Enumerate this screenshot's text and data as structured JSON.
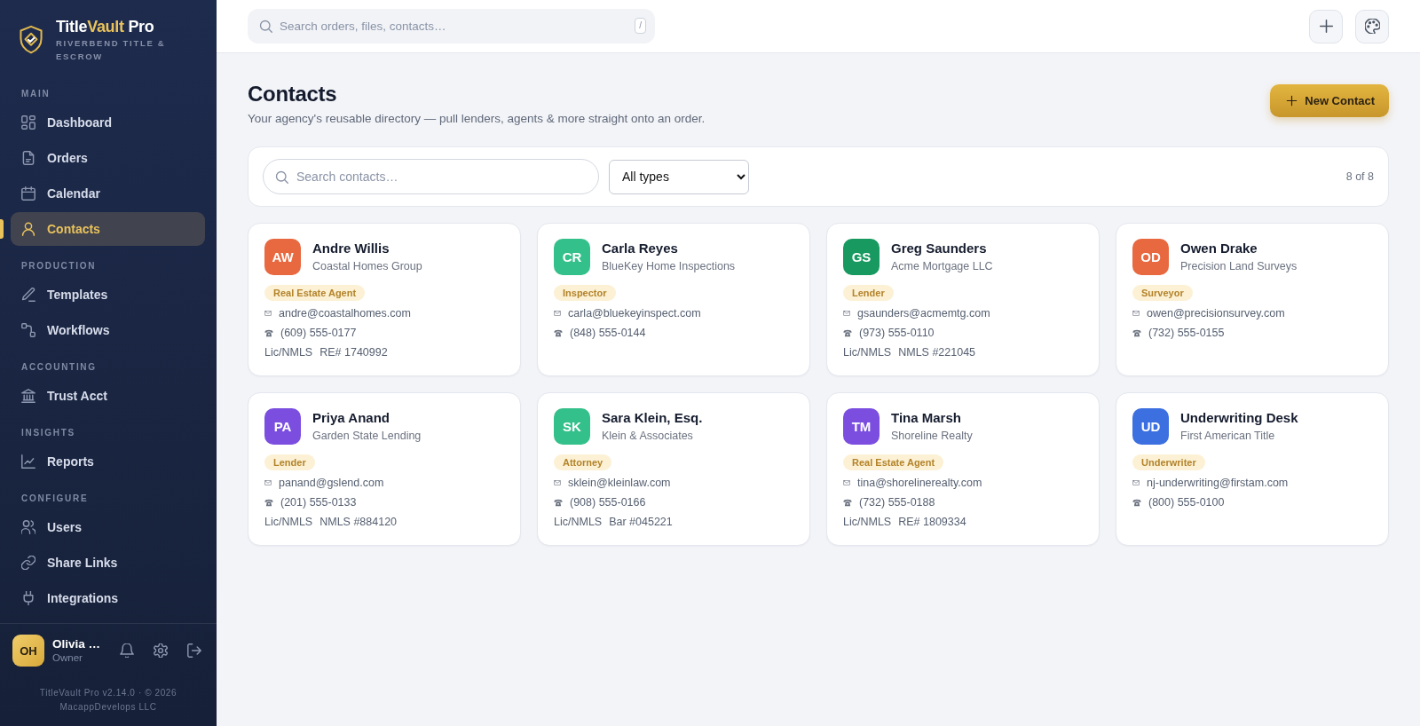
{
  "sidebar": {
    "brand": {
      "name_parts": [
        {
          "text": "Title",
          "accent": false
        },
        {
          "text": "Vault",
          "accent": true
        },
        {
          "text": " Pro",
          "accent": false
        }
      ],
      "subtitle": "RIVERBEND TITLE & ESCROW"
    },
    "sections": [
      {
        "label": "MAIN",
        "items": [
          {
            "label": "Dashboard",
            "selected": false
          },
          {
            "label": "Orders",
            "selected": false
          },
          {
            "label": "Calendar",
            "selected": false
          },
          {
            "label": "Contacts",
            "selected": true
          }
        ]
      },
      {
        "label": "PRODUCTION",
        "items": [
          {
            "label": "Templates",
            "selected": false
          },
          {
            "label": "Workflows",
            "selected": false
          }
        ]
      },
      {
        "label": "ACCOUNTING",
        "items": [
          {
            "label": "Trust Acct",
            "selected": false
          }
        ]
      },
      {
        "label": "INSIGHTS",
        "items": [
          {
            "label": "Reports",
            "selected": false
          }
        ]
      },
      {
        "label": "CONFIGURE",
        "items": [
          {
            "label": "Users",
            "selected": false
          },
          {
            "label": "Share Links",
            "selected": false
          },
          {
            "label": "Integrations",
            "selected": false
          }
        ]
      }
    ],
    "user": {
      "initials": "OH",
      "name": "Olivia …",
      "role": "Owner"
    },
    "footer": "TitleVault Pro v2.14.0 · © 2026 MacappDevelops LLC"
  },
  "topbar": {
    "search": {
      "placeholder": "Search orders, files, contacts…",
      "shortcut": "/"
    }
  },
  "page": {
    "title": "Contacts",
    "subtitle": "Your agency's reusable directory — pull lenders, agents & more straight onto an order.",
    "primary_action": "New Contact"
  },
  "filters": {
    "search_placeholder": "Search contacts…",
    "type_select": "All types",
    "count": "8 of 8"
  },
  "contacts": [
    {
      "initials": "AW",
      "name": "Andre Willis",
      "company": "Coastal Homes Group",
      "color": "#e8683f",
      "role": "Real Estate Agent",
      "email": "andre@coastalhomes.com",
      "phone": "(609) 555-0177",
      "license_label": "Lic/NMLS",
      "license": "RE# 1740992"
    },
    {
      "initials": "CR",
      "name": "Carla Reyes",
      "company": "BlueKey Home Inspections",
      "color": "#34c08a",
      "role": "Inspector",
      "email": "carla@bluekeyinspect.com",
      "phone": "(848) 555-0144"
    },
    {
      "initials": "GS",
      "name": "Greg Saunders",
      "company": "Acme Mortgage LLC",
      "color": "#17995f",
      "role": "Lender",
      "email": "gsaunders@acmemtg.com",
      "phone": "(973) 555-0110",
      "license_label": "Lic/NMLS",
      "license": "NMLS #221045"
    },
    {
      "initials": "OD",
      "name": "Owen Drake",
      "company": "Precision Land Surveys",
      "color": "#e8683f",
      "role": "Surveyor",
      "email": "owen@precisionsurvey.com",
      "phone": "(732) 555-0155"
    },
    {
      "initials": "PA",
      "name": "Priya Anand",
      "company": "Garden State Lending",
      "color": "#7b4ee0",
      "role": "Lender",
      "email": "panand@gslend.com",
      "phone": "(201) 555-0133",
      "license_label": "Lic/NMLS",
      "license": "NMLS #884120"
    },
    {
      "initials": "SK",
      "name": "Sara Klein, Esq.",
      "company": "Klein & Associates",
      "color": "#34c08a",
      "role": "Attorney",
      "email": "sklein@kleinlaw.com",
      "phone": "(908) 555-0166",
      "license_label": "Lic/NMLS",
      "license": "Bar #045221"
    },
    {
      "initials": "TM",
      "name": "Tina Marsh",
      "company": "Shoreline Realty",
      "color": "#7b4ee0",
      "role": "Real Estate Agent",
      "email": "tina@shorelinerealty.com",
      "phone": "(732) 555-0188",
      "license_label": "Lic/NMLS",
      "license": "RE# 1809334"
    },
    {
      "initials": "UD",
      "name": "Underwriting Desk",
      "company": "First American Title",
      "color": "#3c6fe0",
      "role": "Underwriter",
      "email": "nj-underwriting@firstam.com",
      "phone": "(800) 555-0100"
    }
  ]
}
